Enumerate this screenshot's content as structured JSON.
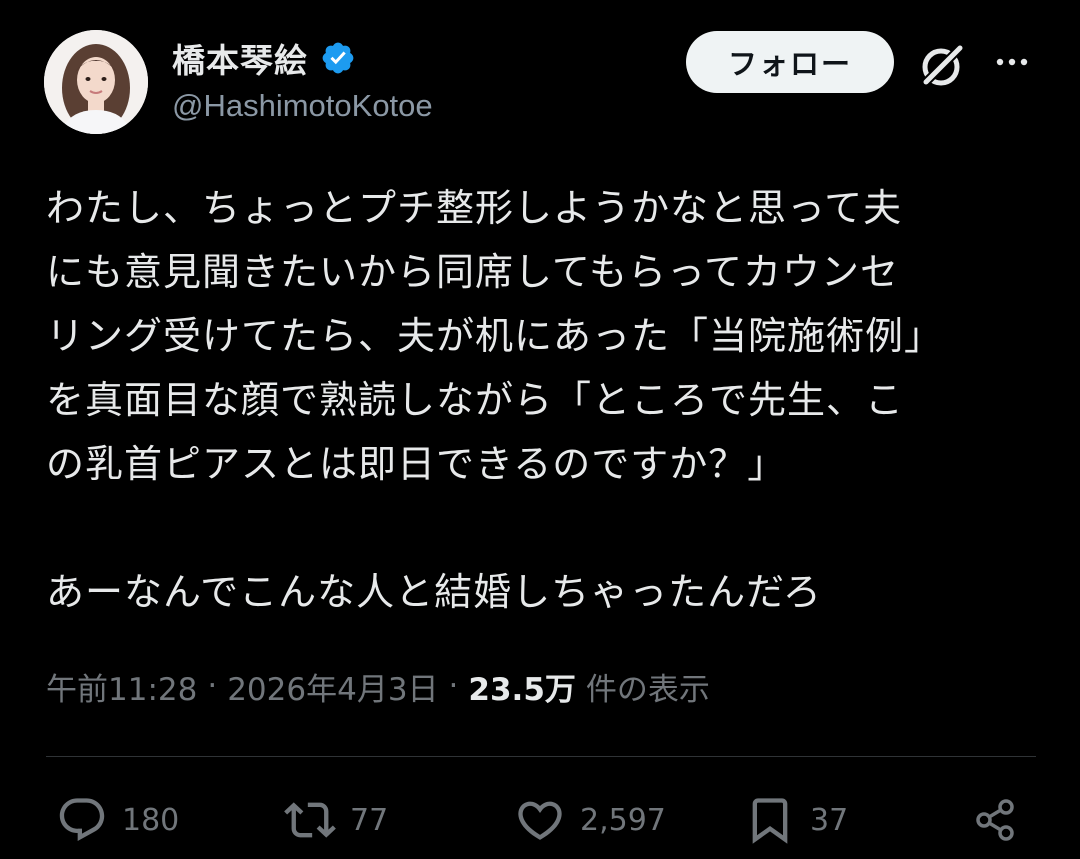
{
  "author": {
    "display_name": "橋本琴絵",
    "handle": "@HashimotoKotoe",
    "verified": true
  },
  "header": {
    "follow_label": "フォロー"
  },
  "tweet": {
    "text": "わたし、ちょっとプチ整形しようかなと思って夫\nにも意見聞きたいから同席してもらってカウンセ\nリング受けてたら、夫が机にあった「当院施術例」\nを真面目な顔で熟読しながら「ところで先生、こ\nの乳首ピアスとは即日できるのですか？」\n\nあーなんでこんな人と結婚しちゃったんだろ"
  },
  "meta": {
    "time": "午前11:28",
    "date": "2026年4月3日",
    "separator": "·",
    "views": "23.5万",
    "views_suffix": "件の表示"
  },
  "actions": {
    "replies": "180",
    "reposts": "77",
    "likes": "2,597",
    "bookmarks": "37"
  },
  "icons": {
    "verified": "verified-badge-icon",
    "grok": "grok-icon",
    "more": "more-icon",
    "reply": "reply-icon",
    "repost": "repost-icon",
    "like": "heart-icon",
    "bookmark": "bookmark-icon",
    "share": "share-icon"
  },
  "colors": {
    "background": "#000000",
    "text": "#e7e9ea",
    "secondary": "#71767b",
    "verified": "#1d9bf0",
    "follow_bg": "#eff3f4"
  }
}
